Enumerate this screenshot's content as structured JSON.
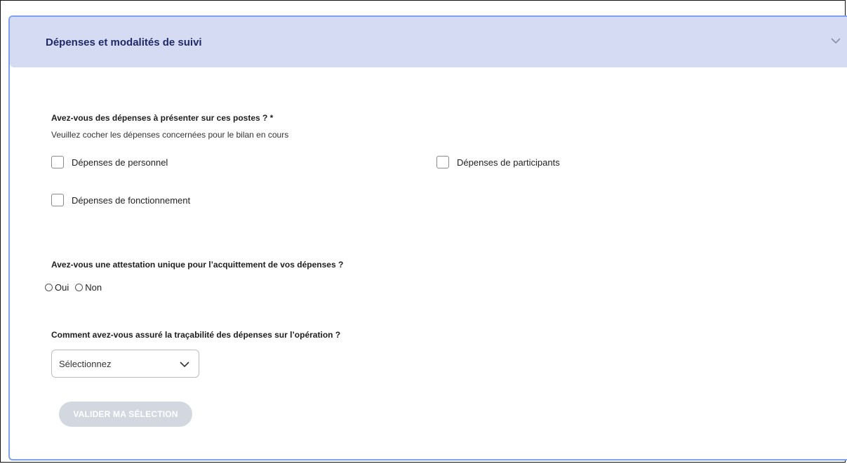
{
  "section": {
    "title": "Dépenses et modalités de suivi",
    "toggle_icon": "chevron-down-icon"
  },
  "expenses_question": {
    "title": "Avez-vous des dépenses à présenter sur ces postes ? *",
    "hint": "Veuillez cocher les dépenses concernées pour le bilan en cours",
    "options": [
      {
        "label": "Dépenses de personnel",
        "checked": false
      },
      {
        "label": "Dépenses de participants",
        "checked": false
      },
      {
        "label": "Dépenses de fonctionnement",
        "checked": false
      }
    ]
  },
  "attestation_question": {
    "title": "Avez-vous une attestation unique pour l’acquittement de vos dépenses ?",
    "options": [
      {
        "label": "Oui",
        "selected": false
      },
      {
        "label": "Non",
        "selected": false
      }
    ]
  },
  "traceability_question": {
    "title": "Comment avez-vous assuré la traçabilité des dépenses sur l’opération ?",
    "select_value": "Sélectionnez"
  },
  "actions": {
    "validate_label": "VALIDER MA SÉLECTION",
    "validate_enabled": false
  },
  "colors": {
    "header_bg": "#d5dbf2",
    "border_accent": "#7f9ff0",
    "title_text": "#1f2a66",
    "disabled_button": "#d3d8e0"
  }
}
